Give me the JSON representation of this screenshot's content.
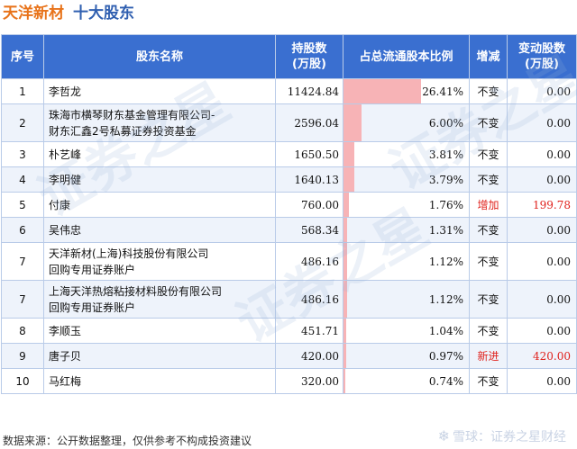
{
  "header": {
    "company": "天洋新材",
    "subtitle": "十大股东"
  },
  "table": {
    "columns": [
      "序号",
      "股东名称",
      "持股数\n(万股)",
      "占总流通股本比例",
      "增减",
      "变动股数\n(万股)"
    ],
    "rows": [
      {
        "idx": "1",
        "name": "李哲龙",
        "shares": "11424.84",
        "pct": "26.41%",
        "pct_value": 26.41,
        "change": "不变",
        "variation": "0.00"
      },
      {
        "idx": "2",
        "name": "珠海市横琴财东基金管理有限公司-\n财东汇鑫2号私募证券投资基金",
        "shares": "2596.04",
        "pct": "6.00%",
        "pct_value": 6.0,
        "change": "不变",
        "variation": "0.00"
      },
      {
        "idx": "3",
        "name": "朴艺峰",
        "shares": "1650.50",
        "pct": "3.81%",
        "pct_value": 3.81,
        "change": "不变",
        "variation": "0.00"
      },
      {
        "idx": "4",
        "name": "李明健",
        "shares": "1640.13",
        "pct": "3.79%",
        "pct_value": 3.79,
        "change": "不变",
        "variation": "0.00"
      },
      {
        "idx": "5",
        "name": "付康",
        "shares": "760.00",
        "pct": "1.76%",
        "pct_value": 1.76,
        "change": "增加",
        "variation": "199.78"
      },
      {
        "idx": "6",
        "name": "吴伟忠",
        "shares": "568.34",
        "pct": "1.31%",
        "pct_value": 1.31,
        "change": "不变",
        "variation": "0.00"
      },
      {
        "idx": "7",
        "name": "天洋新材(上海)科技股份有限公司\n回购专用证券账户",
        "shares": "486.16",
        "pct": "1.12%",
        "pct_value": 1.12,
        "change": "不变",
        "variation": "0.00"
      },
      {
        "idx": "7",
        "name": "上海天洋热熔粘接材料股份有限公司\n回购专用证券账户",
        "shares": "486.16",
        "pct": "1.12%",
        "pct_value": 1.12,
        "change": "不变",
        "variation": "0.00"
      },
      {
        "idx": "8",
        "name": "李顺玉",
        "shares": "451.71",
        "pct": "1.04%",
        "pct_value": 1.04,
        "change": "不变",
        "variation": "0.00"
      },
      {
        "idx": "9",
        "name": "唐子贝",
        "shares": "420.00",
        "pct": "0.97%",
        "pct_value": 0.97,
        "change": "新进",
        "variation": "420.00"
      },
      {
        "idx": "10",
        "name": "马红梅",
        "shares": "320.00",
        "pct": "0.74%",
        "pct_value": 0.74,
        "change": "不变",
        "variation": "0.00"
      }
    ]
  },
  "footer": {
    "source": "数据来源：公开数据整理，仅供参考不构成投资建议"
  },
  "brand": {
    "text": "雪球：证券之星财经"
  },
  "watermarks": [
    "证券之星",
    "证券之星",
    "证券之星"
  ],
  "colors": {
    "title_orange": "#e8731a",
    "title_blue": "#2f5fb0",
    "header_bg": "#3a6fd0",
    "bar": "#f7b3b6",
    "increase": "#e0221d"
  }
}
